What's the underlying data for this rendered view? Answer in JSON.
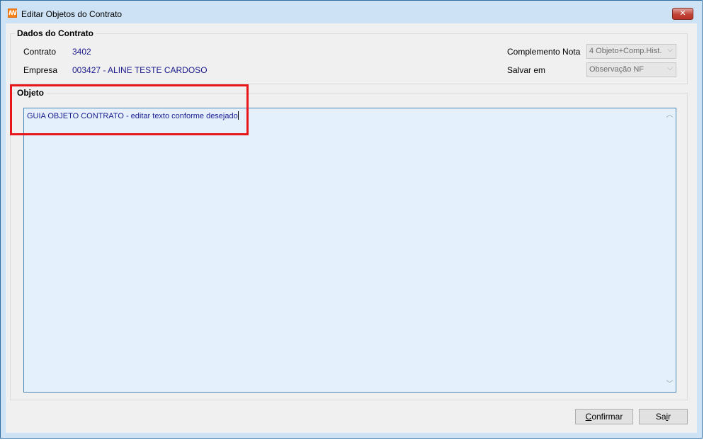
{
  "window": {
    "title": "Editar Objetos do Contrato",
    "close_label": "✕"
  },
  "dados": {
    "group_title": "Dados do Contrato",
    "contrato_label": "Contrato",
    "contrato_value": "3402",
    "empresa_label": "Empresa",
    "empresa_value": "003427 - ALINE TESTE CARDOSO",
    "complemento_label": "Complemento Nota",
    "complemento_value": "4 Objeto+Comp.Hist.",
    "salvar_label": "Salvar em",
    "salvar_value": "Observação NF"
  },
  "objeto": {
    "group_title": "Objeto",
    "text": "GUIA OBJETO CONTRATO - editar texto conforme desejado"
  },
  "buttons": {
    "confirmar_first": "C",
    "confirmar_rest": "onfirmar",
    "sair_first": "Sa",
    "sair_underline": "i",
    "sair_rest": "r"
  },
  "icons": {
    "app": "app-icon",
    "close": "close-icon",
    "dropdown": "chevron-down-icon",
    "scroll_up": "chevron-up-icon",
    "scroll_down": "chevron-down-icon"
  },
  "colors": {
    "highlight": "#e8161b",
    "value_text": "#1a1a8c",
    "memo_bg": "#e4f1fd"
  }
}
